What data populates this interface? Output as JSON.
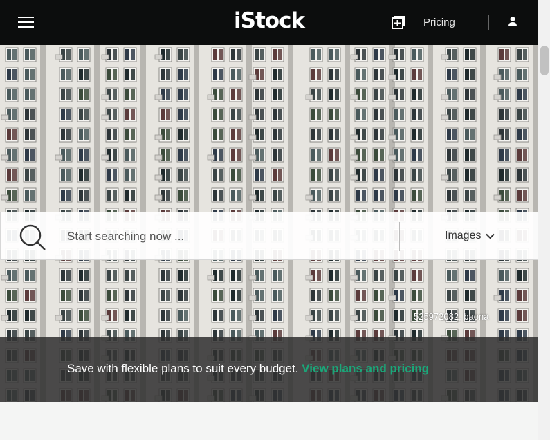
{
  "header": {
    "logo": "iStock",
    "pricing_label": "Pricing"
  },
  "search": {
    "placeholder": "Start searching now ...",
    "type_label": "Images"
  },
  "hero": {
    "credit": "525972082, baona"
  },
  "promo": {
    "text": "Save with flexible plans to suit every budget.",
    "link": "View plans and pricing"
  },
  "colors": {
    "header_bg": "#0c0d0d",
    "accent_green": "#1aa87a"
  },
  "icons": [
    "menu-icon",
    "board-add-icon",
    "user-icon",
    "search-icon",
    "chevron-down-icon"
  ]
}
